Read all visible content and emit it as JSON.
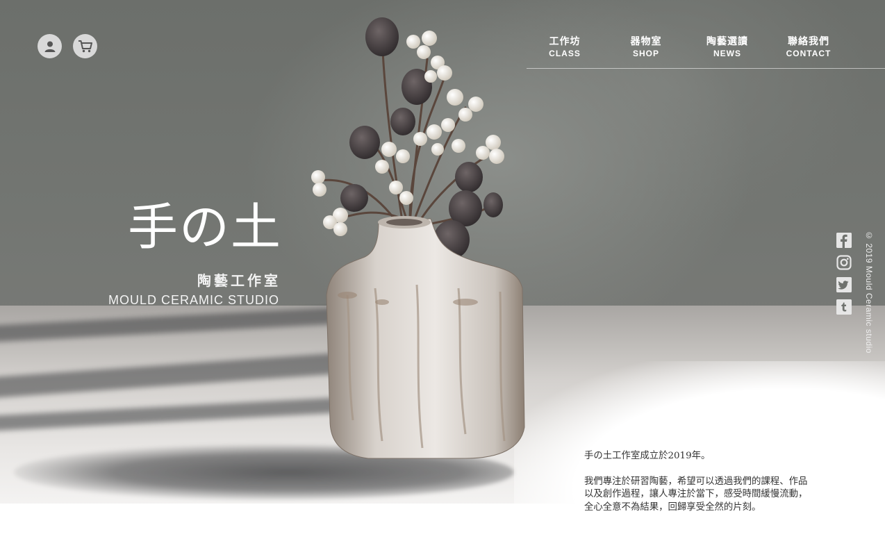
{
  "header": {
    "icons": {
      "user": "user-icon",
      "cart": "cart-icon"
    }
  },
  "nav": {
    "items": [
      {
        "zh": "工作坊",
        "en": "CLASS"
      },
      {
        "zh": "器物室",
        "en": "SHOP"
      },
      {
        "zh": "陶藝選讀",
        "en": "NEWS"
      },
      {
        "zh": "聯絡我們",
        "en": "CONTACT"
      }
    ]
  },
  "brand": {
    "title": "手の土",
    "subtitle_zh": "陶藝工作室",
    "subtitle_en": "MOULD CERAMIC STUDIO"
  },
  "social": {
    "icons": [
      "facebook-icon",
      "instagram-icon",
      "twitter-icon",
      "tumblr-icon"
    ],
    "copyright": "© 2019 Mould Ceramic studio"
  },
  "intro": {
    "line1": "手の土工作室成立於2019年。",
    "line2": "我們專注於研習陶藝，希望可以透過我們的課程、作品",
    "line3": "以及創作過程，讓人專注於當下，感受時間緩慢流動，",
    "line4": "全心全意不為結果，回歸享受全然的片刻。"
  },
  "colors": {
    "wall": "#6f726e",
    "floor": "#d3d0cd",
    "icon_bg": "#d9d9d9",
    "text_dark": "#333333"
  }
}
